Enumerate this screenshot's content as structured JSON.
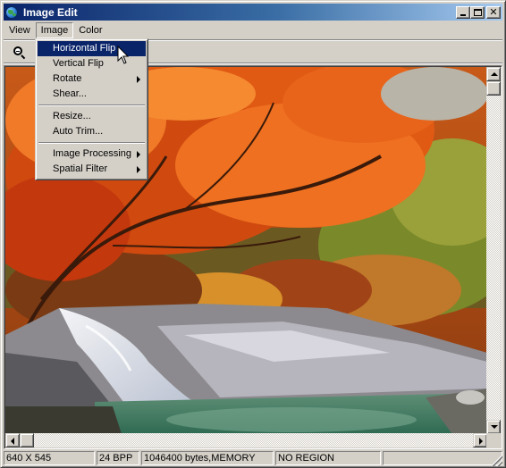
{
  "window": {
    "title": "Image Edit"
  },
  "menubar": {
    "items": [
      "View",
      "Image",
      "Color"
    ]
  },
  "image_menu": {
    "items": [
      {
        "label": "Horizontal Flip",
        "active": true,
        "submenu": false
      },
      {
        "label": "Vertical Flip",
        "active": false,
        "submenu": false
      },
      {
        "label": "Rotate",
        "active": false,
        "submenu": true
      },
      {
        "label": "Shear...",
        "active": false,
        "submenu": false
      },
      {
        "label": "Resize...",
        "active": false,
        "submenu": false
      },
      {
        "label": "Auto Trim...",
        "active": false,
        "submenu": false
      },
      {
        "label": "Image Processing",
        "active": false,
        "submenu": true
      },
      {
        "label": "Spatial Filter",
        "active": false,
        "submenu": true
      }
    ]
  },
  "status": {
    "dimensions": "640 X 545",
    "bpp": "24 BPP",
    "memory": "1046400 bytes,MEMORY",
    "region": "NO REGION"
  },
  "colors": {
    "titlebar_start": "#0a246a",
    "titlebar_end": "#a6caf0",
    "highlight": "#0a246a",
    "face": "#d4d0c8"
  },
  "icons": {
    "app": "globe-icon",
    "zoom": "zoom-out-icon"
  }
}
